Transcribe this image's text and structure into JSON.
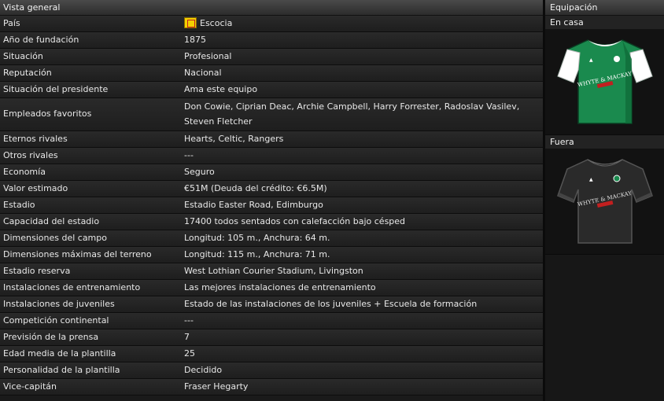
{
  "overview": {
    "title": "Vista general",
    "rows": [
      {
        "label": "País",
        "value": "Escocia"
      },
      {
        "label": "Año de fundación",
        "value": "1875"
      },
      {
        "label": "Situación",
        "value": "Profesional"
      },
      {
        "label": "Reputación",
        "value": "Nacional"
      },
      {
        "label": "Situación del presidente",
        "value": "Ama este equipo"
      },
      {
        "label": "Empleados favoritos",
        "value": "Don Cowie, Ciprian Deac, Archie Campbell, Harry Forrester, Radoslav Vasilev, Steven Fletcher"
      },
      {
        "label": "Eternos rivales",
        "value": "Hearts, Celtic, Rangers"
      },
      {
        "label": "Otros rivales",
        "value": "---"
      },
      {
        "label": "Economía",
        "value": "Seguro"
      },
      {
        "label": "Valor estimado",
        "value": "€51M (Deuda del crédito: €6.5M)"
      },
      {
        "label": "Estadio",
        "value": "Estadio Easter Road, Edimburgo"
      },
      {
        "label": "Capacidad del estadio",
        "value": "17400 todos sentados con calefacción bajo césped"
      },
      {
        "label": "Dimensiones del campo",
        "value": "Longitud: 105 m., Anchura: 64 m."
      },
      {
        "label": "Dimensiones máximas del terreno",
        "value": "Longitud: 115 m., Anchura: 71 m."
      },
      {
        "label": "Estadio reserva",
        "value": "West Lothian Courier Stadium, Livingston"
      },
      {
        "label": "Instalaciones de entrenamiento",
        "value": "Las mejores instalaciones de entrenamiento"
      },
      {
        "label": "Instalaciones de juveniles",
        "value": "Estado de las instalaciones de los juveniles + Escuela de formación"
      },
      {
        "label": "Competición continental",
        "value": "---"
      },
      {
        "label": "Previsión de la prensa",
        "value": "7"
      },
      {
        "label": "Edad media de la plantilla",
        "value": "25"
      },
      {
        "label": "Personalidad de la plantilla",
        "value": "Decidido"
      },
      {
        "label": "Vice-capitán",
        "value": "Fraser Hegarty"
      }
    ]
  },
  "kits": {
    "title": "Equipación",
    "home": {
      "label": "En casa",
      "sponsor": "WHYTE & MACKAY",
      "body_color": "#1a8a4e",
      "sleeve_color": "#ffffff"
    },
    "away": {
      "label": "Fuera",
      "sponsor": "WHYTE & MACKAY",
      "body_color": "#2a2a2a",
      "sleeve_color": "#333333"
    }
  },
  "icons": {
    "country_flag": "flag-icon"
  }
}
